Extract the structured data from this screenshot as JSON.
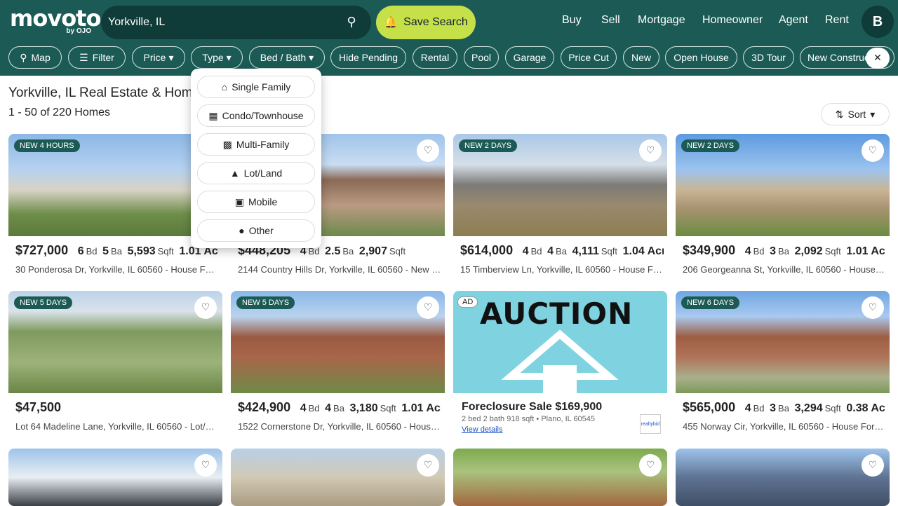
{
  "header": {
    "logo_text": "movoto",
    "logo_sub": "by OJO",
    "search_value": "Yorkville, IL",
    "search_icon": "search-icon",
    "save_search_label": "Save Search",
    "nav": [
      "Buy",
      "Sell",
      "Mortgage",
      "Homeowner",
      "Agent",
      "Rent"
    ],
    "avatar_initial": "B"
  },
  "filters": {
    "chips": [
      "Map",
      "Filter",
      "Price",
      "Type",
      "Bed / Bath",
      "Hide Pending",
      "Rental",
      "Pool",
      "Garage",
      "Price Cut",
      "New",
      "Open House",
      "3D Tour",
      "New Construction"
    ]
  },
  "type_dropdown": {
    "options": [
      "Single Family",
      "Condo/Townhouse",
      "Multi-Family",
      "Lot/Land",
      "Mobile",
      "Other"
    ]
  },
  "results": {
    "title": "Yorkville, IL Real Estate & Homes For Sale",
    "count": "1 - 50 of 220 Homes",
    "sort_label": "Sort"
  },
  "units": {
    "bd": "Bd",
    "ba": "Ba",
    "sqft": "Sqft"
  },
  "listings": [
    {
      "badge": "NEW 4 HOURS",
      "price": "$727,000",
      "beds": "6",
      "baths": "5",
      "sqft": "5,593",
      "extra": "1.01 Acres",
      "address": "30 Ponderosa Dr, Yorkville, IL 60560",
      "type": "- House For Sale"
    },
    {
      "badge": "",
      "price": "$448,205",
      "beds": "4",
      "baths": "2.5",
      "sqft": "2,907",
      "extra": "",
      "address": "2144 Country Hills Dr, Yorkville, IL 60560",
      "type": "- New Construction"
    },
    {
      "badge": "NEW 2 DAYS",
      "price": "$614,000",
      "beds": "4",
      "baths": "4",
      "sqft": "4,111",
      "extra": "1.04 Acres",
      "address": "15 Timberview Ln, Yorkville, IL 60560",
      "type": "- House For Sale"
    },
    {
      "badge": "NEW 2 DAYS",
      "price": "$349,900",
      "beds": "4",
      "baths": "3",
      "sqft": "2,092",
      "extra": "1.01 Acres",
      "address": "206 Georgeanna St, Yorkville, IL 60560",
      "type": "- House For Sale"
    },
    {
      "badge": "NEW 5 DAYS",
      "price": "$47,500",
      "beds": "",
      "baths": "",
      "sqft": "",
      "extra": "",
      "address": "Lot 64 Madeline Lane, Yorkville, IL 60560",
      "type": "- Lot/Land For Sale"
    },
    {
      "badge": "NEW 5 DAYS",
      "price": "$424,900",
      "beds": "4",
      "baths": "4",
      "sqft": "3,180",
      "extra": "1.01 Acres",
      "address": "1522 Cornerstone Dr, Yorkville, IL 60560",
      "type": "- House For Sale"
    },
    {
      "badge": "NEW 6 DAYS",
      "price": "$565,000",
      "beds": "4",
      "baths": "3",
      "sqft": "3,294",
      "extra": "0.38 Acres",
      "address": "455 Norway Cir, Yorkville, IL 60560",
      "type": "- House For Sale"
    }
  ],
  "auction": {
    "ad_label": "AD",
    "image_text": "AUCTION",
    "title": "Foreclosure Sale $169,900",
    "subtitle": "2 bed  2 bath  918 sqft  •  Plano, IL 60545",
    "link": "View details",
    "logo_text": "realtybid"
  },
  "icons": {
    "heart": "heart-icon",
    "map": "map-icon",
    "filter": "filter-icon",
    "chevron": "chevron-down-icon",
    "sort": "sort-icon",
    "close": "close-icon"
  },
  "colors": {
    "brand": "#1c5b55",
    "accent": "#c6e04a",
    "search_bg": "#0f3c38"
  }
}
